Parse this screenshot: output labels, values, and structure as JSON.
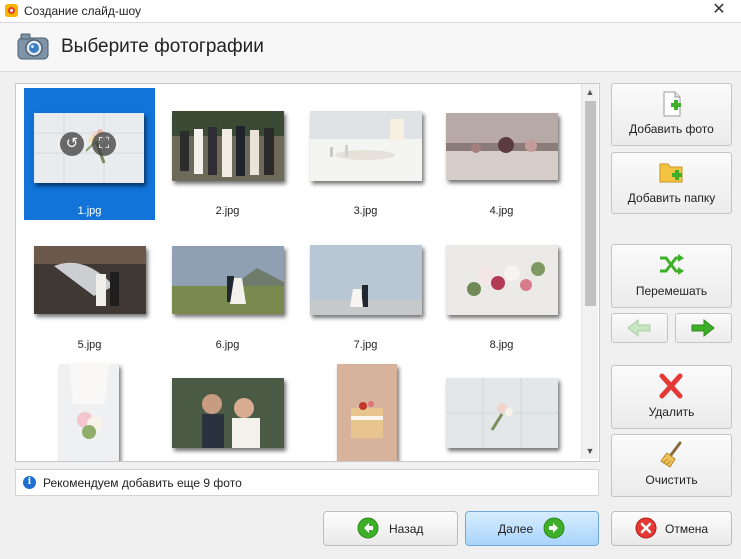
{
  "window": {
    "title": "Создание слайд-шоу",
    "close_glyph": "✕"
  },
  "header": {
    "title": "Выберите фотографии"
  },
  "gallery": {
    "files": [
      "1.jpg",
      "2.jpg",
      "3.jpg",
      "4.jpg",
      "5.jpg",
      "6.jpg",
      "7.jpg",
      "8.jpg"
    ],
    "selected": "1.jpg",
    "overlay": {
      "rotate_glyph": "↺",
      "crop_glyph": "⛶"
    }
  },
  "scrollbar": {
    "up_glyph": "▲",
    "down_glyph": "▼"
  },
  "info": {
    "icon_glyph": "i",
    "text": "Рекомендуем добавить еще 9 фото"
  },
  "sidebar": {
    "add_photo": "Добавить фото",
    "add_folder": "Добавить папку",
    "shuffle": "Перемешать",
    "delete": "Удалить",
    "clear": "Очистить"
  },
  "footer": {
    "back": "Назад",
    "next": "Далее",
    "cancel": "Отмена"
  },
  "colors": {
    "selection": "#1273d8",
    "accent_green": "#3fae29",
    "delete_red": "#e53935"
  }
}
